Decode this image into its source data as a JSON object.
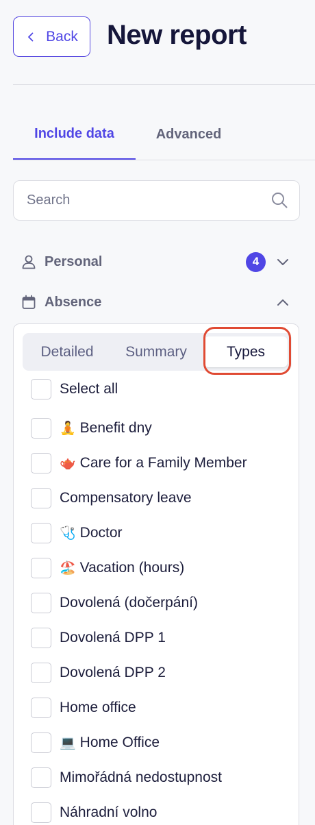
{
  "header": {
    "back_label": "Back",
    "title": "New report"
  },
  "tabs": [
    {
      "label": "Include data",
      "active": true
    },
    {
      "label": "Advanced",
      "active": false
    }
  ],
  "search": {
    "placeholder": "Search",
    "value": ""
  },
  "sections": {
    "personal": {
      "label": "Personal",
      "count": "4",
      "icon": "person-icon",
      "expanded": false
    },
    "absence": {
      "label": "Absence",
      "icon": "calendar-icon",
      "expanded": true
    }
  },
  "absence_panel": {
    "segments": [
      {
        "label": "Detailed",
        "active": false
      },
      {
        "label": "Summary",
        "active": false
      },
      {
        "label": "Types",
        "active": true
      }
    ],
    "select_all_label": "Select all",
    "items": [
      {
        "emoji": "🧘",
        "label": "Benefit dny"
      },
      {
        "emoji": "🫖",
        "label": "Care for a Family Member"
      },
      {
        "emoji": "",
        "label": "Compensatory leave"
      },
      {
        "emoji": "🩺",
        "label": "Doctor"
      },
      {
        "emoji": "🏖️",
        "label": "Vacation (hours)"
      },
      {
        "emoji": "",
        "label": "Dovolená (dočerpání)"
      },
      {
        "emoji": "",
        "label": "Dovolená DPP 1"
      },
      {
        "emoji": "",
        "label": "Dovolená DPP 2"
      },
      {
        "emoji": "",
        "label": "Home office"
      },
      {
        "emoji": "💻",
        "label": "Home Office"
      },
      {
        "emoji": "",
        "label": "Mimořádná nedostupnost"
      },
      {
        "emoji": "",
        "label": "Náhradní volno"
      }
    ]
  },
  "colors": {
    "accent": "#5046e5",
    "highlight": "#e04a33",
    "background": "#f7f8fa"
  }
}
